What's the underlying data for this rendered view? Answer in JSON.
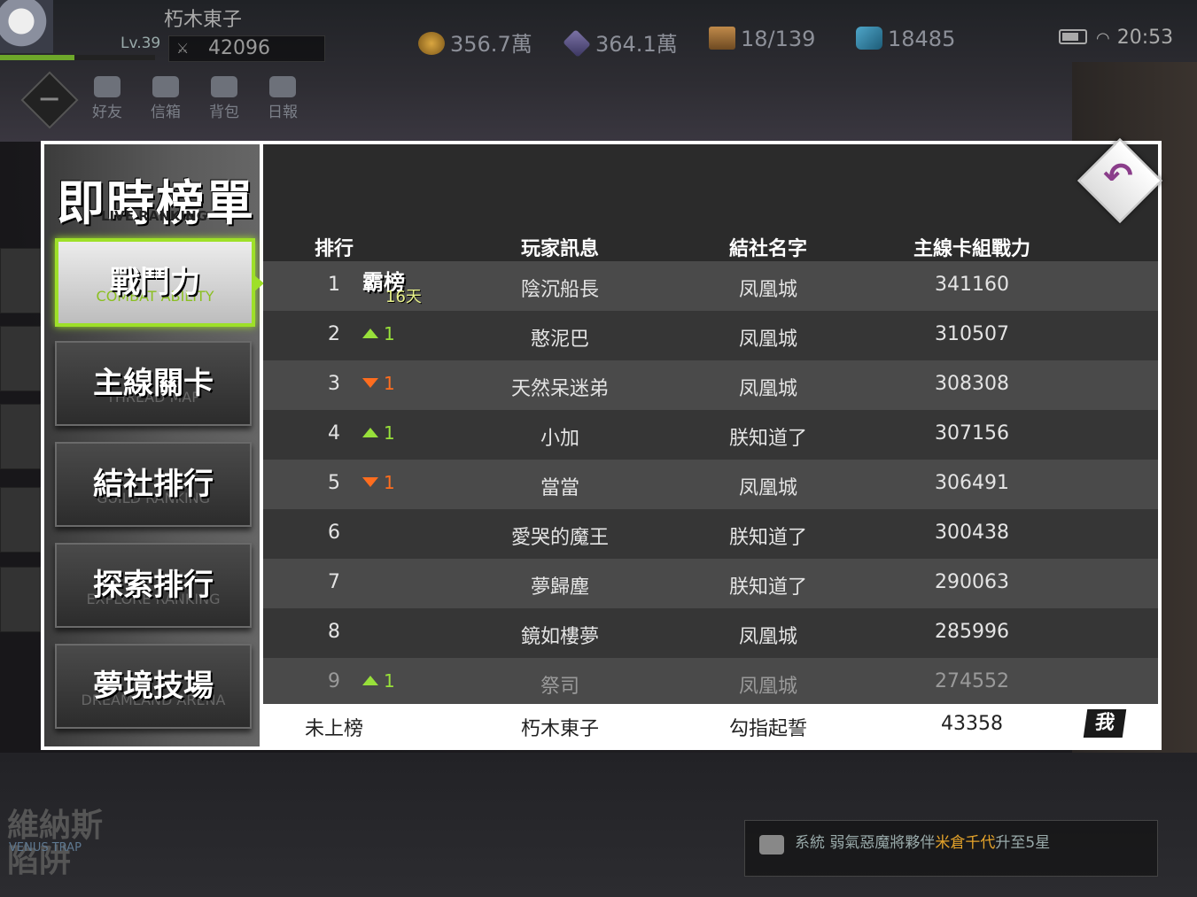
{
  "player": {
    "name": "朽木東子",
    "level": "Lv.39",
    "power": "42096",
    "xp_fraction": 0.48
  },
  "resources": [
    {
      "icon": "gold-coin-icon",
      "value": "356.7萬"
    },
    {
      "icon": "crystal-icon",
      "value": "364.1萬"
    },
    {
      "icon": "card-box-icon",
      "value": "18/139"
    },
    {
      "icon": "diamond-icon",
      "value": "18485"
    }
  ],
  "status": {
    "time": "20:53"
  },
  "toolbar": {
    "friends": "好友",
    "mail": "信箱",
    "bag": "背包",
    "daily": "日報"
  },
  "sidebar": {
    "title": "即時榜單",
    "subtitle": "LIVE RANKING",
    "tabs": [
      {
        "label": "戰鬥力",
        "sub": "COMBAT ABILITY",
        "active": true
      },
      {
        "label": "主線關卡",
        "sub": "THREAD MAP"
      },
      {
        "label": "結社排行",
        "sub": "GUILD RANKING"
      },
      {
        "label": "探索排行",
        "sub": "EXPLORE RANKING"
      },
      {
        "label": "夢境技場",
        "sub": "DREAMLAND ARENA"
      }
    ]
  },
  "table": {
    "headers": {
      "rank": "排行",
      "player": "玩家訊息",
      "guild": "結社名字",
      "power": "主線卡組戰力"
    },
    "rows": [
      {
        "rank": "1",
        "badge": "霸榜",
        "badge_days": "16天",
        "name": "陰沉船長",
        "guild": "凤凰城",
        "power": "341160"
      },
      {
        "rank": "2",
        "trend": "up",
        "change": "1",
        "name": "憨泥巴",
        "guild": "凤凰城",
        "power": "310507"
      },
      {
        "rank": "3",
        "trend": "down",
        "change": "1",
        "name": "天然呆迷弟",
        "guild": "凤凰城",
        "power": "308308"
      },
      {
        "rank": "4",
        "trend": "up",
        "change": "1",
        "name": "小加",
        "guild": "朕知道了",
        "power": "307156"
      },
      {
        "rank": "5",
        "trend": "down",
        "change": "1",
        "name": "當當",
        "guild": "凤凰城",
        "power": "306491"
      },
      {
        "rank": "6",
        "name": "愛哭的魔王",
        "guild": "朕知道了",
        "power": "300438"
      },
      {
        "rank": "7",
        "name": "夢歸塵",
        "guild": "朕知道了",
        "power": "290063"
      },
      {
        "rank": "8",
        "name": "鏡如樓夢",
        "guild": "凤凰城",
        "power": "285996"
      },
      {
        "rank": "9",
        "trend": "up",
        "change": "1",
        "name": "祭司",
        "guild": "凤凰城",
        "power": "274552"
      }
    ],
    "me": {
      "rank": "未上榜",
      "name": "朽木東子",
      "guild": "勾指起誓",
      "power": "43358",
      "tag": "我"
    }
  },
  "logo": {
    "title": "維納斯\n陷阱",
    "sub": "VENUS TRAP"
  },
  "chat": {
    "prefix": "系統 弱氣惡魔將夥伴",
    "highlight": "米倉千代",
    "suffix": "升至5星"
  }
}
